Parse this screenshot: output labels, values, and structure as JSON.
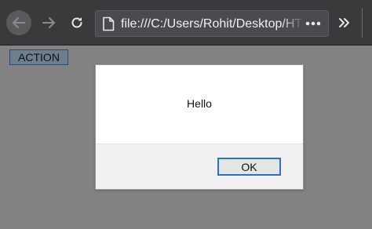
{
  "browser": {
    "url": "file:///C:/Users/Rohit/Desktop/HTML",
    "icons": {
      "back": "arrow-left-icon",
      "forward": "arrow-right-icon",
      "reload": "reload-icon",
      "page": "page-icon",
      "page_actions": "more-horizontal-icon",
      "overflow": "double-chevron-right-icon"
    }
  },
  "page": {
    "action_label": "ACTION"
  },
  "dialog": {
    "message": "Hello",
    "ok_label": "OK"
  },
  "colors": {
    "toolbar": "#3a3a3c",
    "page_background": "#838383",
    "ok_border": "#2b72c6"
  }
}
